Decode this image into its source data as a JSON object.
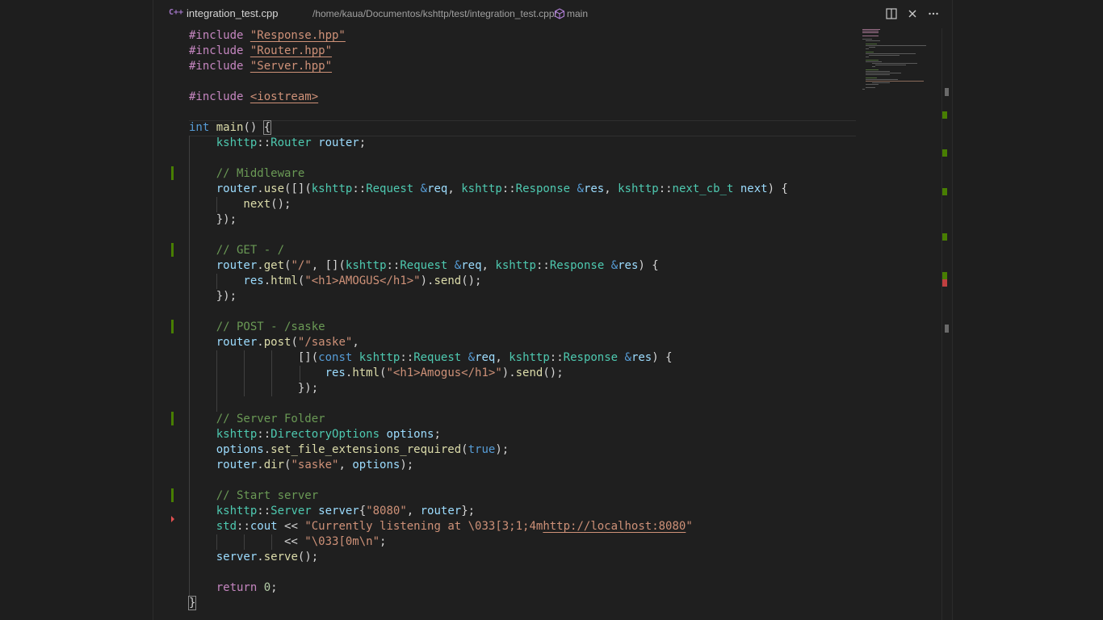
{
  "tab": {
    "icon": "C++",
    "filename": "integration_test.cpp",
    "breadcrumb_path": "/home/kaua/Documentos/kshttp/test/integration_test.cpp/",
    "breadcrumb_symbol": "main"
  },
  "toolbar": {
    "split_icon": "split-editor-icon",
    "close_icon": "close-icon",
    "more_icon": "more-icon"
  },
  "colors": {
    "background": "#1f1f1f",
    "keyword": "#569cd6",
    "preprocessor": "#c586c0",
    "string": "#ce9178",
    "comment": "#6a9955",
    "type": "#4ec9b0",
    "function": "#dcdcaa",
    "variable": "#9cdcfe",
    "number": "#b5cea8",
    "gutter_added": "#487e02"
  },
  "code": {
    "l1": {
      "a": "#include ",
      "b": "\"Response.hpp\""
    },
    "l2": {
      "a": "#include ",
      "b": "\"Router.hpp\""
    },
    "l3": {
      "a": "#include ",
      "b": "\"Server.hpp\""
    },
    "l5": {
      "a": "#include ",
      "b": "<iostream>"
    },
    "l7": {
      "kw": "int",
      "fn": " main",
      "rest": "() ",
      "br": "{"
    },
    "l8": {
      "ns": "    kshttp",
      "sep": "::",
      "ty": "Router",
      "var": " router",
      "end": ";"
    },
    "l10": {
      "cm": "    // Middleware"
    },
    "l11": {
      "v1": "    router",
      "p1": ".",
      "f1": "use",
      "p2": "([](",
      "n1": "kshttp",
      "p3": "::",
      "t1": "Request",
      "s1": " &",
      "v2": "req",
      "p4": ", ",
      "n2": "kshttp",
      "p5": "::",
      "t2": "Response",
      "s2": " &",
      "v3": "res",
      "p6": ", ",
      "n3": "kshttp",
      "p7": "::",
      "t3": "next_cb_t",
      "v4": " next",
      "p8": ") {"
    },
    "l12": {
      "f1": "        next",
      "p1": "();"
    },
    "l13": {
      "p1": "    });"
    },
    "l15": {
      "cm": "    // GET - /"
    },
    "l16": {
      "v1": "    router",
      "p1": ".",
      "f1": "get",
      "p2": "(",
      "s1": "\"/\"",
      "p3": ", [](",
      "n1": "kshttp",
      "p4": "::",
      "t1": "Request",
      "a1": " &",
      "v2": "req",
      "p5": ", ",
      "n2": "kshttp",
      "p6": "::",
      "t2": "Response",
      "a2": " &",
      "v3": "res",
      "p7": ") {"
    },
    "l17": {
      "v1": "        res",
      "p1": ".",
      "f1": "html",
      "p2": "(",
      "s1": "\"<h1>AMOGUS</h1>\"",
      "p3": ").",
      "f2": "send",
      "p4": "();"
    },
    "l18": {
      "p1": "    });"
    },
    "l20": {
      "cm": "    // POST - /saske"
    },
    "l21": {
      "v1": "    router",
      "p1": ".",
      "f1": "post",
      "p2": "(",
      "s1": "\"/saske\"",
      "p3": ","
    },
    "l22": {
      "p1": "                [](",
      "k1": "const",
      "n1": " kshttp",
      "p2": "::",
      "t1": "Request",
      "a1": " &",
      "v1": "req",
      "p3": ", ",
      "n2": "kshttp",
      "p4": "::",
      "t2": "Response",
      "a2": " &",
      "v2": "res",
      "p5": ") {"
    },
    "l23": {
      "v1": "                    res",
      "p1": ".",
      "f1": "html",
      "p2": "(",
      "s1": "\"<h1>Amogus</h1>\"",
      "p3": ").",
      "f2": "send",
      "p4": "();"
    },
    "l24": {
      "p1": "                });"
    },
    "l26": {
      "cm": "    // Server Folder"
    },
    "l27": {
      "n1": "    kshttp",
      "p1": "::",
      "t1": "DirectoryOptions",
      "v1": " options",
      "p2": ";"
    },
    "l28": {
      "v1": "    options",
      "p1": ".",
      "f1": "set_file_extensions_required",
      "p2": "(",
      "k1": "true",
      "p3": ");"
    },
    "l29": {
      "v1": "    router",
      "p1": ".",
      "f1": "dir",
      "p2": "(",
      "s1": "\"saske\"",
      "p3": ", ",
      "v2": "options",
      "p4": ");"
    },
    "l31": {
      "cm": "    // Start server"
    },
    "l32": {
      "n1": "    kshttp",
      "p1": "::",
      "t1": "Server",
      "v1": " server",
      "p2": "{",
      "s1": "\"8080\"",
      "p3": ", ",
      "v2": "router",
      "p4": "};"
    },
    "l33": {
      "n1": "    std",
      "p1": "::",
      "v1": "cout",
      "p2": " << ",
      "s1": "\"Currently listening at \\033[3;1;4m",
      "s2": "http://localhost:8080",
      "s3": "\""
    },
    "l34": {
      "p1": "              << ",
      "s1": "\"\\033[0m\\n\"",
      "p2": ";"
    },
    "l35": {
      "v1": "    server",
      "p1": ".",
      "f1": "serve",
      "p2": "();"
    },
    "l37": {
      "k1": "    return",
      "n1": " 0",
      "p1": ";"
    },
    "l38": {
      "br": "}"
    }
  }
}
